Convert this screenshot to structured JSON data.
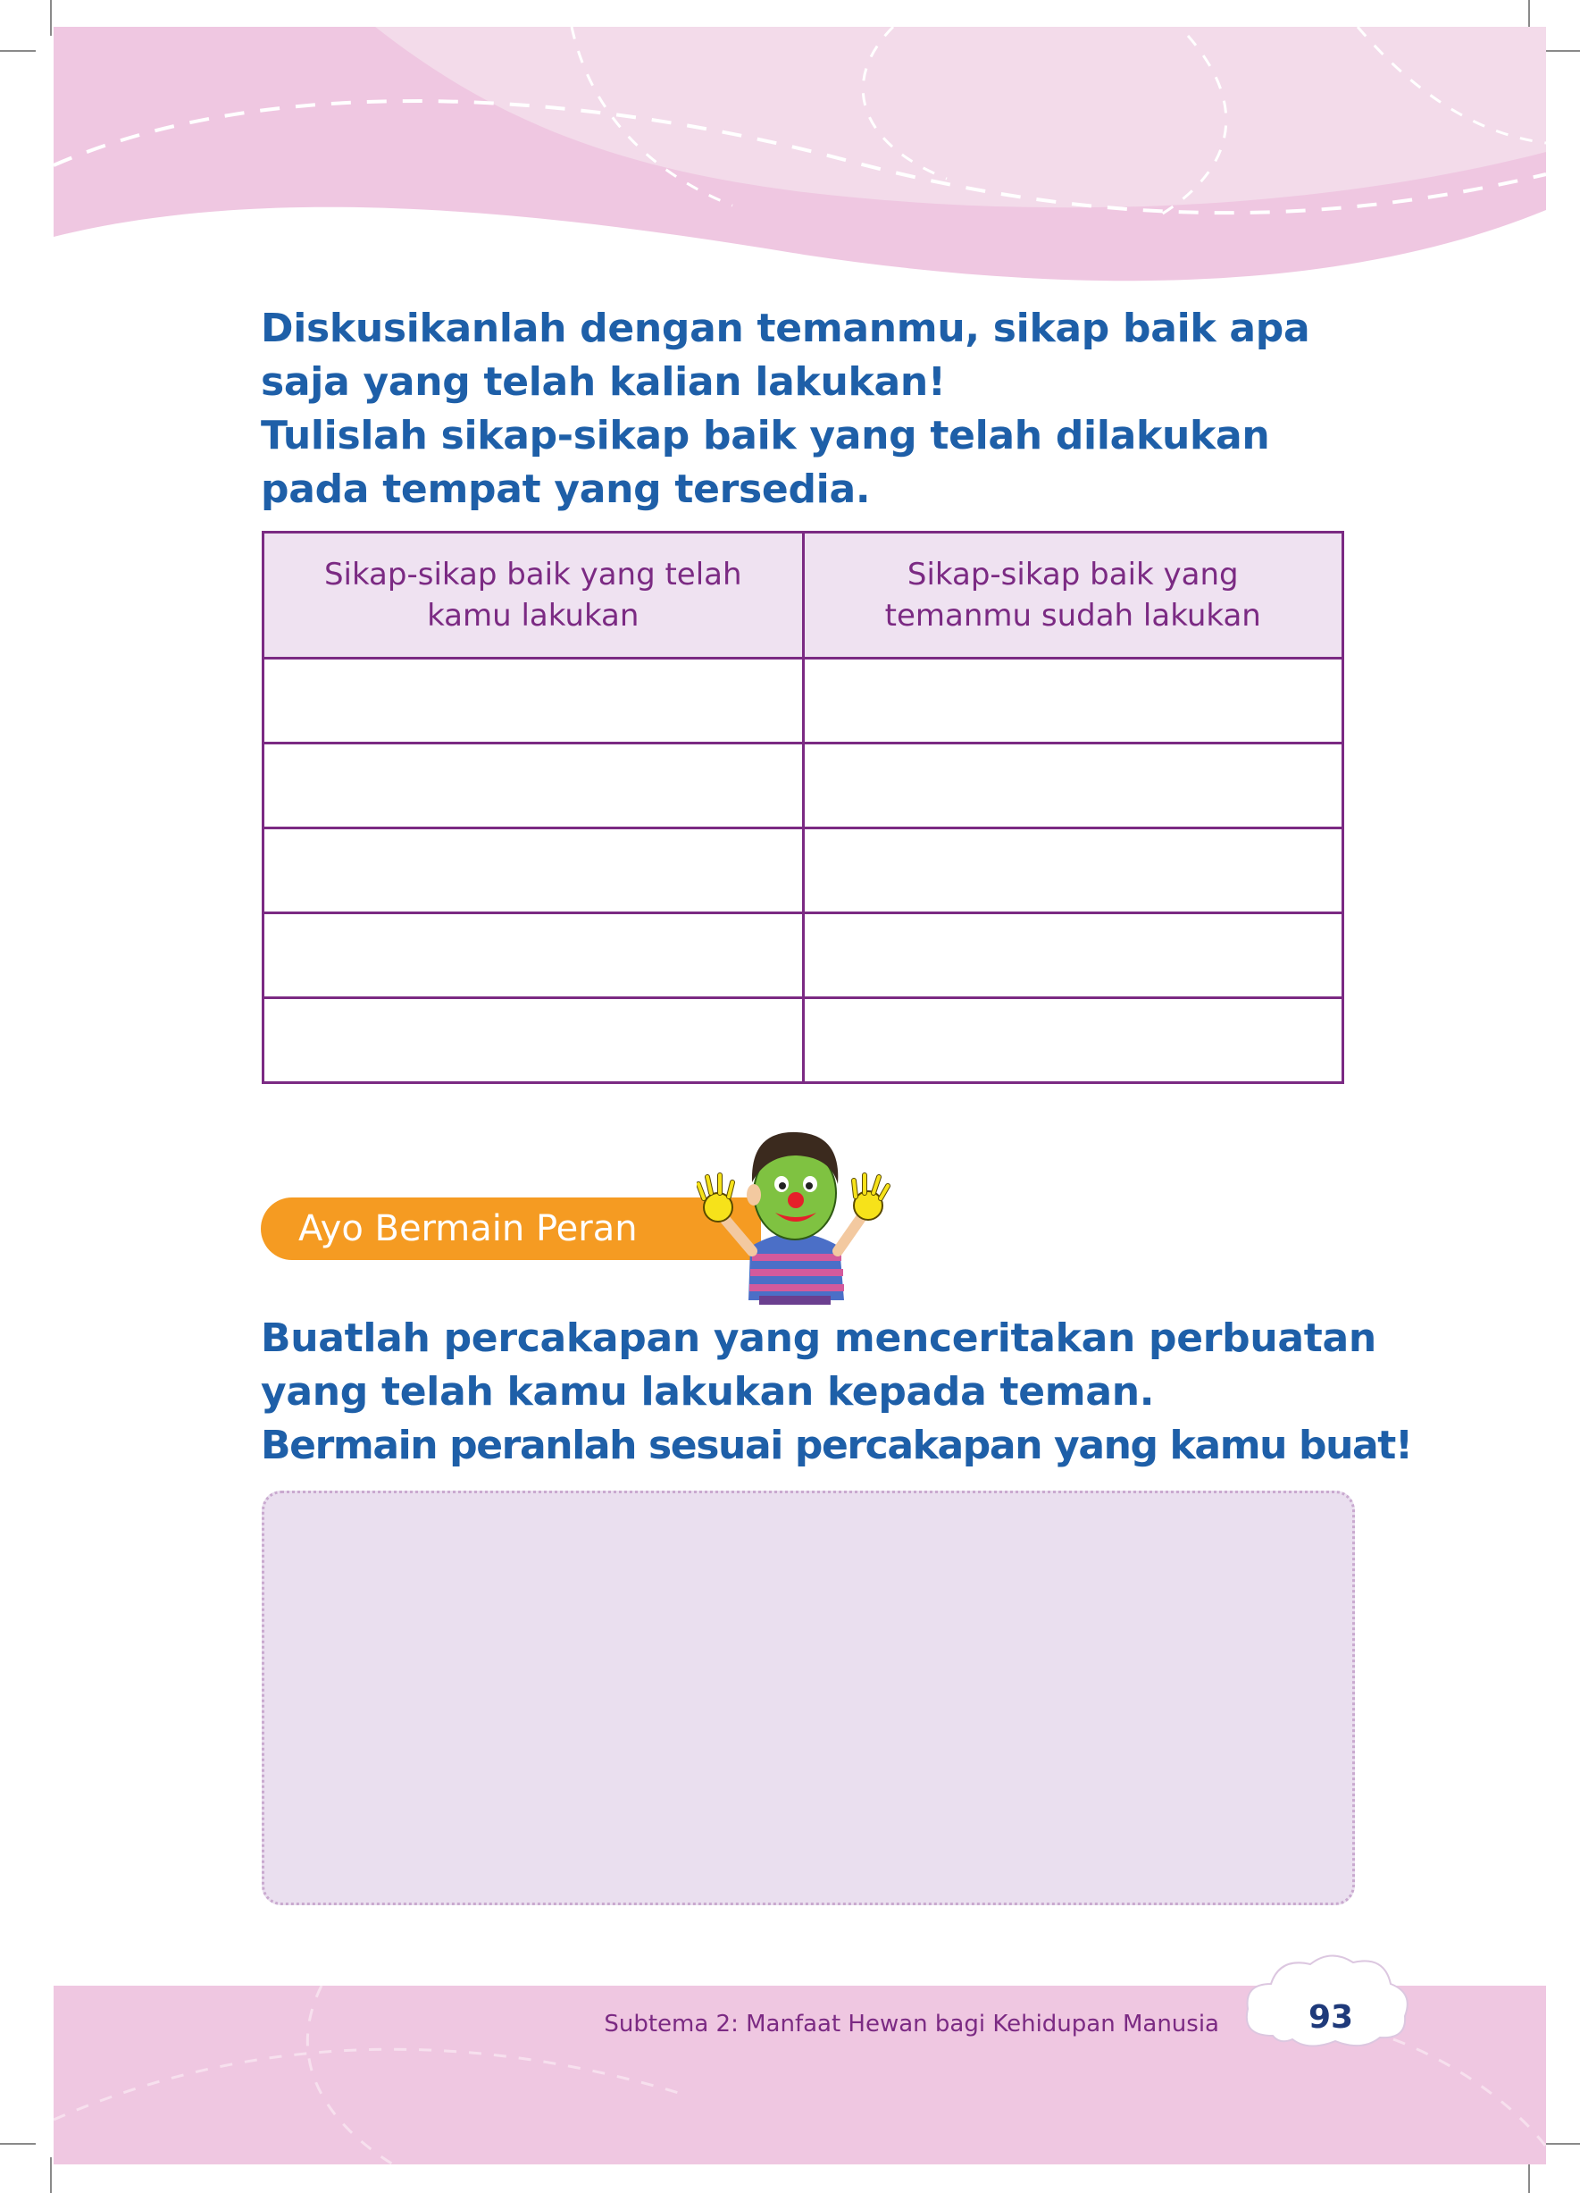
{
  "instructions_top": [
    "Diskusikanlah dengan temanmu, sikap baik apa",
    "saja yang telah kalian lakukan!",
    "Tulislah sikap-sikap baik yang telah dilakukan",
    "pada tempat yang tersedia."
  ],
  "table": {
    "headers": [
      [
        "Sikap-sikap baik yang telah",
        "kamu lakukan"
      ],
      [
        "Sikap-sikap baik yang",
        "temanmu sudah lakukan"
      ]
    ],
    "rows": [
      [
        "",
        ""
      ],
      [
        "",
        ""
      ],
      [
        "",
        ""
      ],
      [
        "",
        ""
      ],
      [
        "",
        ""
      ]
    ]
  },
  "section_label": "Ayo Bermain Peran",
  "instructions_bottom": [
    "Buatlah percakapan yang menceritakan perbuatan",
    "yang telah kamu lakukan kepada teman.",
    "Bermain peranlah sesuai percakapan yang kamu buat!"
  ],
  "writing_area_value": "",
  "footer": {
    "subtitle": "Subtema 2: Manfaat Hewan bagi Kehidupan Manusia",
    "page_number": "93"
  },
  "colors": {
    "heading_blue": "#1e5fa8",
    "table_purple": "#7b2a83",
    "header_pink": "#efc7e1",
    "pill_orange": "#f59b22",
    "box_lilac": "#eadfef"
  },
  "icons": {
    "character": "clown-face-boy-icon",
    "cloud": "cloud-badge-icon"
  }
}
